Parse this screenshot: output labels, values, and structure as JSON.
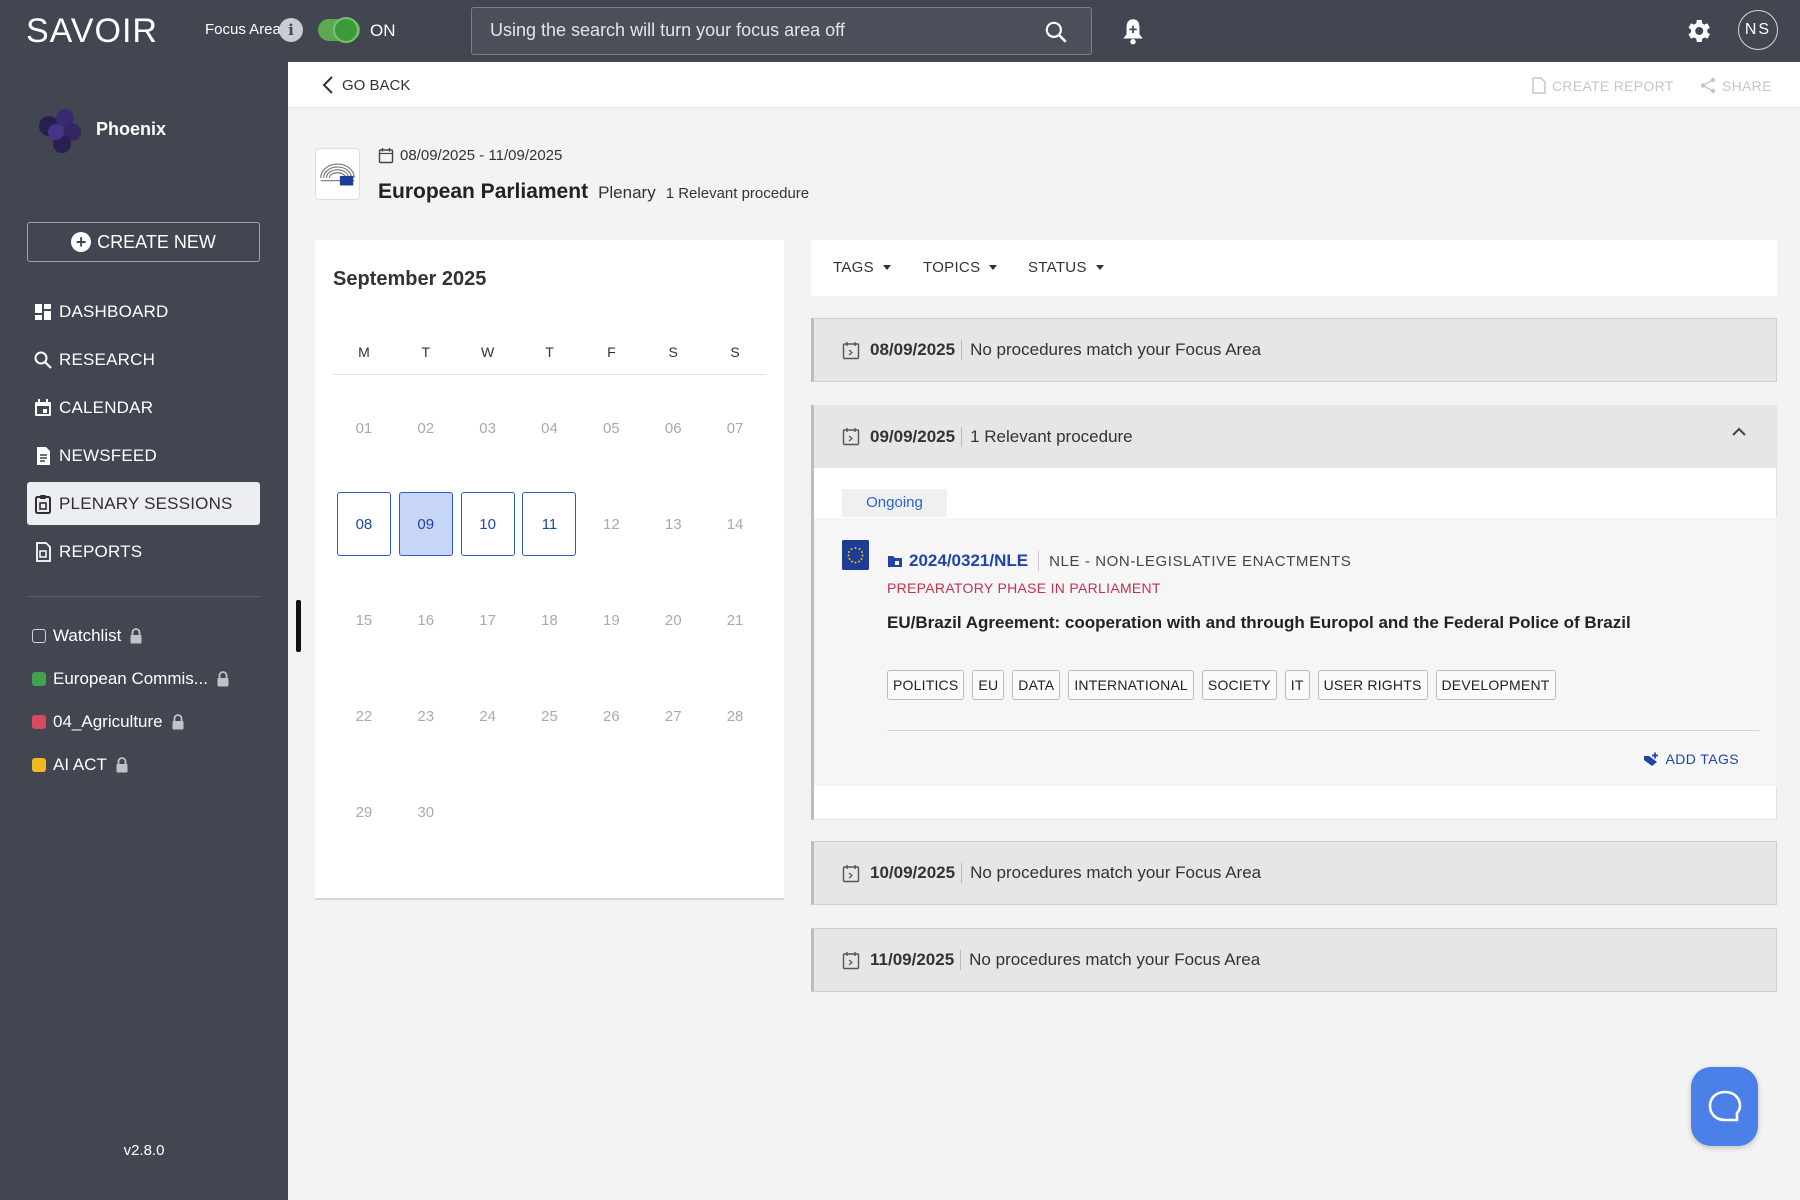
{
  "topbar": {
    "logo": "SAVOIR",
    "focus_area_label": "Focus Area",
    "focus_toggle_state": "ON",
    "search_placeholder": "Using the search will turn your focus area off",
    "avatar_initials": "NS"
  },
  "sidebar": {
    "brand_name": "Phoenix",
    "create_new_label": "CREATE NEW",
    "nav_items": [
      {
        "label": "DASHBOARD",
        "icon": "dashboard-icon",
        "active": false
      },
      {
        "label": "RESEARCH",
        "icon": "search-icon",
        "active": false
      },
      {
        "label": "CALENDAR",
        "icon": "calendar-icon",
        "active": false
      },
      {
        "label": "NEWSFEED",
        "icon": "document-icon",
        "active": false
      },
      {
        "label": "PLENARY SESSIONS",
        "icon": "clipboard-icon",
        "active": true
      },
      {
        "label": "REPORTS",
        "icon": "report-icon",
        "active": false
      }
    ],
    "focus_areas": [
      {
        "label": "Watchlist",
        "color": "#414650"
      },
      {
        "label": "European Commis...",
        "color": "#3fa34d"
      },
      {
        "label": "04_Agriculture",
        "color": "#d94a5e"
      },
      {
        "label": "AI ACT",
        "color": "#f2b822"
      }
    ],
    "version": "v2.8.0"
  },
  "subheader": {
    "go_back": "GO BACK",
    "create_report": "CREATE REPORT",
    "share": "SHARE"
  },
  "session": {
    "date_range": "08/09/2025 - 11/09/2025",
    "institution": "European Parliament",
    "type": "Plenary",
    "relevant_count": "1 Relevant procedure"
  },
  "calendar": {
    "month": "September 2025",
    "weekdays": [
      "M",
      "T",
      "W",
      "T",
      "F",
      "S",
      "S"
    ],
    "days": [
      "01",
      "02",
      "03",
      "04",
      "05",
      "06",
      "07",
      "08",
      "09",
      "10",
      "11",
      "12",
      "13",
      "14",
      "15",
      "16",
      "17",
      "18",
      "19",
      "20",
      "21",
      "22",
      "23",
      "24",
      "25",
      "26",
      "27",
      "28",
      "29",
      "30"
    ],
    "session_days": [
      "08",
      "09",
      "10",
      "11"
    ],
    "selected_day": "09"
  },
  "filters": {
    "tags": "TAGS",
    "topics": "TOPICS",
    "status": "STATUS"
  },
  "days": [
    {
      "date": "08/09/2025",
      "summary": "No procedures match your Focus Area"
    },
    {
      "date": "09/09/2025",
      "summary": "1 Relevant procedure"
    },
    {
      "date": "10/09/2025",
      "summary": "No procedures match your Focus Area"
    },
    {
      "date": "11/09/2025",
      "summary": "No procedures match your Focus Area"
    }
  ],
  "procedure": {
    "status": "Ongoing",
    "id": "2024/0321/NLE",
    "type": "NLE - NON-LEGISLATIVE ENACTMENTS",
    "phase": "PREPARATORY PHASE IN PARLIAMENT",
    "title": "EU/Brazil Agreement: cooperation with and through Europol and the Federal Police of Brazil",
    "tags": [
      "POLITICS",
      "EU",
      "DATA",
      "INTERNATIONAL",
      "SOCIETY",
      "IT",
      "USER RIGHTS",
      "DEVELOPMENT"
    ],
    "add_tags": "ADD TAGS"
  }
}
